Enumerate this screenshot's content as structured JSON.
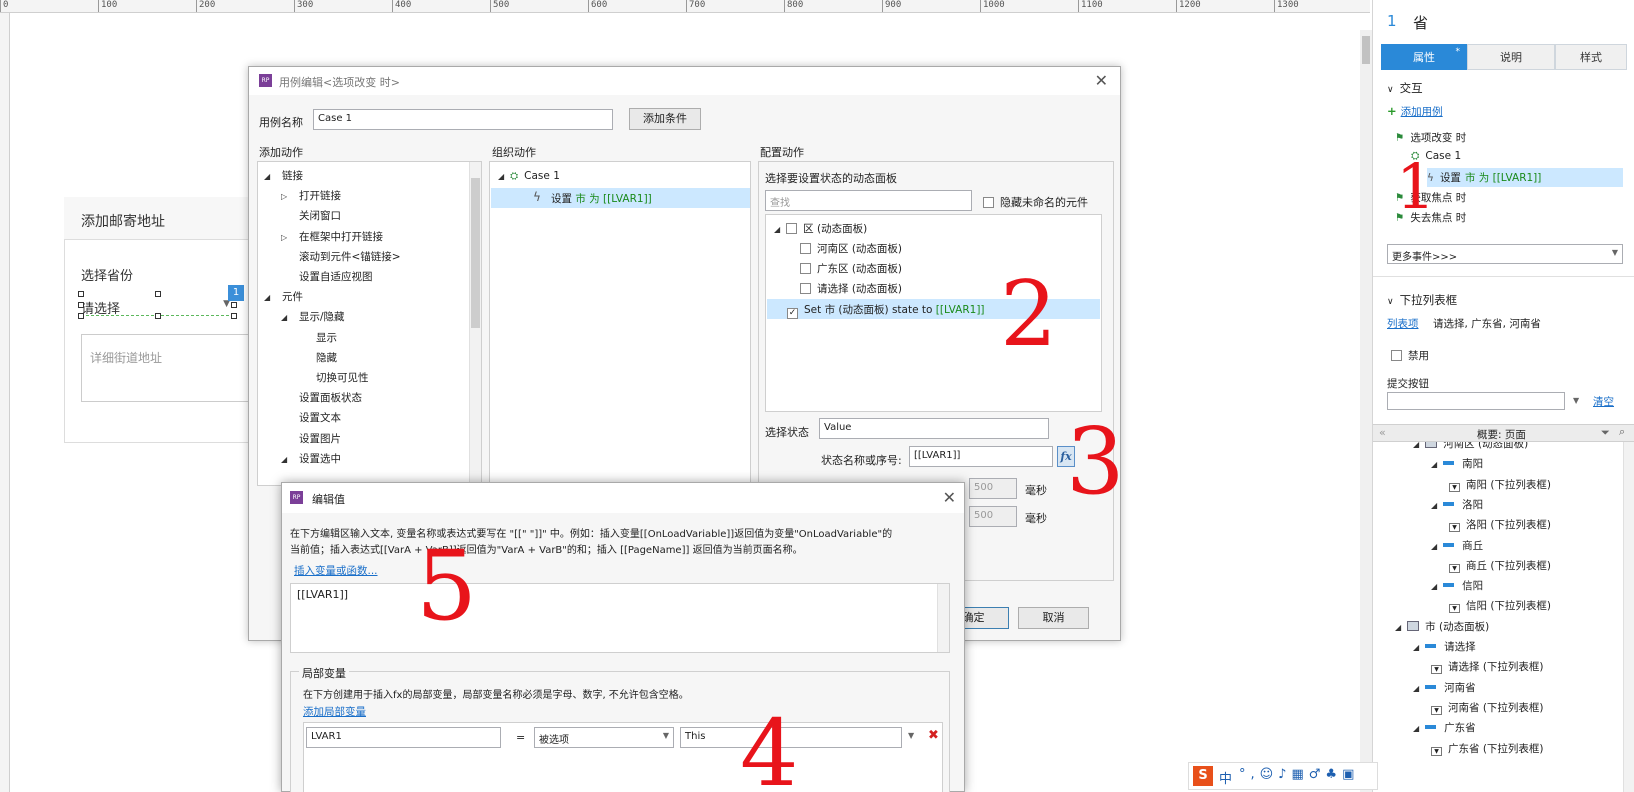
{
  "ruler": {
    "labels": [
      "0",
      "100",
      "200",
      "300",
      "400",
      "500",
      "600",
      "700",
      "800",
      "900",
      "1000",
      "1100",
      "1200",
      "1300"
    ]
  },
  "page": {
    "address_title": "添加邮寄地址",
    "province_label": "选择省份",
    "province_value": "请选择",
    "badge": "1",
    "street_placeholder": "详细街道地址"
  },
  "case_editor": {
    "title": "用例编辑<选项改变 时>",
    "case_name_label": "用例名称",
    "case_name_value": "Case 1",
    "add_condition": "添加条件",
    "add_action_header": "添加动作",
    "organize_header": "组织动作",
    "configure_header": "配置动作",
    "actions_tree": [
      {
        "text": "链接",
        "level": 0,
        "arrow": "◢"
      },
      {
        "text": "打开链接",
        "level": 1,
        "arrow": "▷"
      },
      {
        "text": "关闭窗口",
        "level": 1,
        "arrow": ""
      },
      {
        "text": "在框架中打开链接",
        "level": 1,
        "arrow": "▷"
      },
      {
        "text": "滚动到元件<锚链接>",
        "level": 1,
        "arrow": ""
      },
      {
        "text": "设置自适应视图",
        "level": 1,
        "arrow": ""
      },
      {
        "text": "元件",
        "level": 0,
        "arrow": "◢"
      },
      {
        "text": "显示/隐藏",
        "level": 1,
        "arrow": "◢"
      },
      {
        "text": "显示",
        "level": 2,
        "arrow": ""
      },
      {
        "text": "隐藏",
        "level": 2,
        "arrow": ""
      },
      {
        "text": "切换可见性",
        "level": 2,
        "arrow": ""
      },
      {
        "text": "设置面板状态",
        "level": 1,
        "arrow": ""
      },
      {
        "text": "设置文本",
        "level": 1,
        "arrow": ""
      },
      {
        "text": "设置图片",
        "level": 1,
        "arrow": ""
      },
      {
        "text": "设置选中",
        "level": 1,
        "arrow": "◢"
      }
    ],
    "org_case": "Case 1",
    "org_action_prefix": "设置",
    "org_action_detail": "市 为 [[LVAR1]]",
    "panel_select_label": "选择要设置状态的动态面板",
    "search_placeholder": "查找",
    "hide_unnamed": "隐藏未命名的元件",
    "panels": [
      {
        "text": "区 (动态面板)",
        "level": 0,
        "checked": false
      },
      {
        "text": "河南区 (动态面板)",
        "level": 1,
        "checked": false
      },
      {
        "text": "广东区 (动态面板)",
        "level": 1,
        "checked": false
      },
      {
        "text": "请选择 (动态面板)",
        "level": 1,
        "checked": false
      }
    ],
    "panel_selected_prefix": "Set 市 (动态面板) state to ",
    "panel_selected_var": "[[LVAR1]]",
    "select_state_label": "选择状态",
    "select_state_value": "Value",
    "state_name_label": "状态名称或序号:",
    "state_name_value": "[[LVAR1]]",
    "fx": "fx",
    "ms1": "500",
    "ms2": "500",
    "ms_unit": "毫秒",
    "ok": "确定",
    "cancel": "取消"
  },
  "edit_value": {
    "title": "编辑值",
    "desc_line1": "在下方编辑区输入文本, 变量名称或表达式要写在 \"[[\" \"]]\" 中。例如：插入变量[[OnLoadVariable]]返回值为变量\"OnLoadVariable\"的",
    "desc_line2": "当前值；插入表达式[[VarA + VarB]]返回值为\"VarA + VarB\"的和；插入 [[PageName]] 返回值为当前页面名称。",
    "insert_link": "插入变量或函数...",
    "value": "[[LVAR1]]",
    "local_vars_header": "局部变量",
    "local_desc": "在下方创建用于插入fx的局部变量，局部变量名称必须是字母、数字, 不允许包含空格。",
    "add_local": "添加局部变量",
    "var_name": "LVAR1",
    "equals": "=",
    "var_type": "被选项",
    "var_target": "This"
  },
  "right_panel": {
    "page_number": "1",
    "widget_name": "省",
    "tabs": [
      "属性",
      "说明",
      "样式"
    ],
    "interaction_header": "交互",
    "add_case": "添加用例",
    "events": [
      {
        "text": "选项改变 时",
        "level": 0
      },
      {
        "text": "Case 1",
        "level": 1
      },
      {
        "text": "设置",
        "detail": "市 为 [[LVAR1]]",
        "level": 2
      },
      {
        "text": "获取焦点 时",
        "level": 0
      },
      {
        "text": "失去焦点 时",
        "level": 0
      }
    ],
    "more_events": "更多事件>>>",
    "dropdown_header": "下拉列表框",
    "list_items_link": "列表项",
    "list_items_value": "请选择, 广东省, 河南省",
    "disabled_label": "禁用",
    "submit_label": "提交按钮",
    "clear_link": "清空",
    "outline_title": "概要: 页面",
    "outline": [
      {
        "text": "河南区 (动态面板)",
        "level": 0,
        "type": "panel"
      },
      {
        "text": "南阳",
        "level": 1,
        "type": "state"
      },
      {
        "text": "南阳 (下拉列表框)",
        "level": 2,
        "type": "dd"
      },
      {
        "text": "洛阳",
        "level": 1,
        "type": "state"
      },
      {
        "text": "洛阳 (下拉列表框)",
        "level": 2,
        "type": "dd"
      },
      {
        "text": "商丘",
        "level": 1,
        "type": "state"
      },
      {
        "text": "商丘 (下拉列表框)",
        "level": 2,
        "type": "dd"
      },
      {
        "text": "信阳",
        "level": 1,
        "type": "state"
      },
      {
        "text": "信阳 (下拉列表框)",
        "level": 2,
        "type": "dd"
      },
      {
        "text": "市 (动态面板)",
        "level": -1,
        "type": "panel"
      },
      {
        "text": "请选择",
        "level": 0,
        "type": "state"
      },
      {
        "text": "请选择 (下拉列表框)",
        "level": 1,
        "type": "dd"
      },
      {
        "text": "河南省",
        "level": 0,
        "type": "state"
      },
      {
        "text": "河南省 (下拉列表框)",
        "level": 1,
        "type": "dd"
      },
      {
        "text": "广东省",
        "level": 0,
        "type": "state"
      },
      {
        "text": "广东省 (下拉列表框)",
        "level": 1,
        "type": "dd"
      }
    ]
  },
  "annotations": [
    "1",
    "2",
    "3",
    "4",
    "5"
  ],
  "ime": {
    "label": "中"
  },
  "colors": {
    "accent": "#2a89d8",
    "annotation": "#e8141b",
    "green_text": "#1a8a1a",
    "selection": "#cce8ff"
  }
}
